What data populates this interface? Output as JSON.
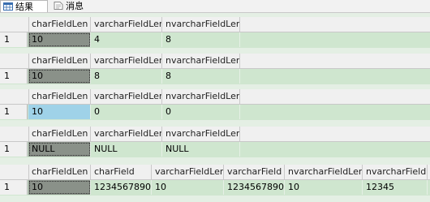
{
  "tabs": [
    {
      "label": "结果",
      "icon": "grid-icon"
    },
    {
      "label": "消息",
      "icon": "message-icon"
    }
  ],
  "grids": [
    {
      "columns": [
        "charFieldLen",
        "varcharFieldLen",
        "nvarcharFieldLen"
      ],
      "rows": [
        {
          "num": "1",
          "cells": [
            "10",
            "4",
            "8"
          ]
        }
      ]
    },
    {
      "columns": [
        "charFieldLen",
        "varcharFieldLen",
        "nvarcharFieldLen"
      ],
      "rows": [
        {
          "num": "1",
          "cells": [
            "10",
            "8",
            "8"
          ]
        }
      ]
    },
    {
      "columns": [
        "charFieldLen",
        "varcharFieldLen",
        "nvarcharFieldLen"
      ],
      "rows": [
        {
          "num": "1",
          "cells": [
            "10",
            "0",
            "0"
          ]
        }
      ]
    },
    {
      "columns": [
        "charFieldLen",
        "varcharFieldLen",
        "nvarcharFieldLen"
      ],
      "rows": [
        {
          "num": "1",
          "cells": [
            "NULL",
            "NULL",
            "NULL"
          ]
        }
      ]
    },
    {
      "columns": [
        "charFieldLen",
        "charField",
        "varcharFieldLen",
        "varcharField",
        "nvarcharFieldLen",
        "nvarcharField"
      ],
      "rows": [
        {
          "num": "1",
          "cells": [
            "10",
            "1234567890",
            "10",
            "1234567890",
            "10",
            "12345"
          ]
        }
      ]
    }
  ]
}
